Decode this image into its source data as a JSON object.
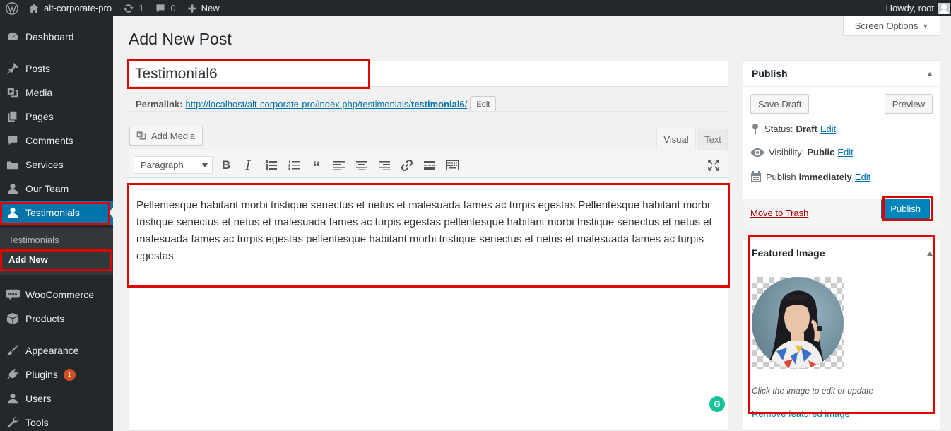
{
  "adminbar": {
    "site_name": "alt-corporate-pro",
    "updates_count": "1",
    "comments_count": "0",
    "new_label": "New",
    "howdy": "Howdy, root"
  },
  "sidebar": {
    "items": [
      {
        "label": "Dashboard",
        "icon": "dashboard-icon"
      },
      {
        "label": "Posts",
        "icon": "pin-icon"
      },
      {
        "label": "Media",
        "icon": "media-icon"
      },
      {
        "label": "Pages",
        "icon": "pages-icon"
      },
      {
        "label": "Comments",
        "icon": "comment-icon"
      },
      {
        "label": "Services",
        "icon": "folder-icon"
      },
      {
        "label": "Our Team",
        "icon": "user-icon"
      },
      {
        "label": "Testimonials",
        "icon": "user-icon"
      },
      {
        "label": "WooCommerce",
        "icon": "woo-icon"
      },
      {
        "label": "Products",
        "icon": "box-icon"
      },
      {
        "label": "Appearance",
        "icon": "brush-icon"
      },
      {
        "label": "Plugins",
        "icon": "plug-icon",
        "badge": "1"
      },
      {
        "label": "Users",
        "icon": "user-icon"
      },
      {
        "label": "Tools",
        "icon": "wrench-icon"
      }
    ],
    "submenu": {
      "parent": "Testimonials",
      "item": "Add New"
    }
  },
  "main": {
    "page_title": "Add New Post",
    "screen_options": "Screen Options",
    "post_title": "Testimonial6",
    "permalink": {
      "label": "Permalink:",
      "url_prefix": "http://localhost/alt-corporate-pro/index.php/testimonials/",
      "slug": "testimonial6",
      "url_suffix": "/",
      "edit_label": "Edit"
    },
    "editor": {
      "add_media": "Add Media",
      "tab_visual": "Visual",
      "tab_text": "Text",
      "format": "Paragraph",
      "content": "Pellentesque habitant morbi tristique senectus et netus et malesuada fames ac turpis egestas.Pellentesque habitant morbi tristique senectus et netus et malesuada fames ac turpis egestas pellentesque habitant morbi tristique senectus et netus et malesuada fames ac turpis egestas pellentesque habitant morbi tristique senectus et netus et malesuada fames ac turpis egestas."
    }
  },
  "publish": {
    "title": "Publish",
    "save_draft": "Save Draft",
    "preview": "Preview",
    "status_label": "Status:",
    "status_value": "Draft",
    "visibility_label": "Visibility:",
    "visibility_value": "Public",
    "publish_label": "Publish",
    "publish_value": "immediately",
    "edit_label": "Edit",
    "trash": "Move to Trash",
    "publish_button": "Publish"
  },
  "featured_image": {
    "title": "Featured Image",
    "hint": "Click the image to edit or update",
    "remove": "Remove featured image"
  },
  "colors": {
    "sidebar_bg": "#23282d",
    "accent": "#0073aa",
    "publish_btn": "#0085ba",
    "highlight": "#e00000"
  }
}
